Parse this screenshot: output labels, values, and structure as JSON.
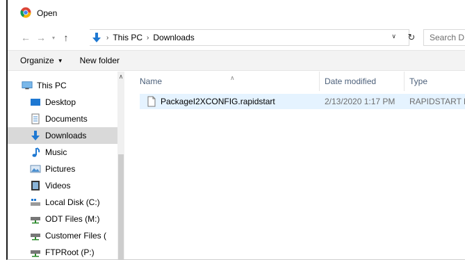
{
  "window": {
    "title": "Open"
  },
  "address": {
    "crumbs": [
      "This PC",
      "Downloads"
    ],
    "search_placeholder": "Search D"
  },
  "commands": {
    "organize": "Organize",
    "new_folder": "New folder"
  },
  "nav": {
    "items": [
      {
        "label": "This PC",
        "icon": "this-pc-icon"
      },
      {
        "label": "Desktop",
        "icon": "desktop-icon"
      },
      {
        "label": "Documents",
        "icon": "documents-icon"
      },
      {
        "label": "Downloads",
        "icon": "downloads-icon",
        "selected": true
      },
      {
        "label": "Music",
        "icon": "music-icon"
      },
      {
        "label": "Pictures",
        "icon": "pictures-icon"
      },
      {
        "label": "Videos",
        "icon": "videos-icon"
      },
      {
        "label": "Local Disk (C:)",
        "icon": "local-disk-icon"
      },
      {
        "label": "ODT Files (M:)",
        "icon": "network-drive-icon"
      },
      {
        "label": "Customer Files (",
        "icon": "network-drive-icon"
      },
      {
        "label": "FTPRoot (P:)",
        "icon": "network-drive-icon"
      }
    ]
  },
  "columns": {
    "name": "Name",
    "date": "Date modified",
    "type": "Type"
  },
  "files": [
    {
      "name": "PackageI2XCONFIG.rapidstart",
      "date": "2/13/2020 1:17 PM",
      "type": "RAPIDSTART F"
    }
  ],
  "colors": {
    "accent": "#1e78d2",
    "selected_nav": "#d9d9d9",
    "selected_row": "#e5f3ff",
    "header_text": "#4c607a"
  }
}
